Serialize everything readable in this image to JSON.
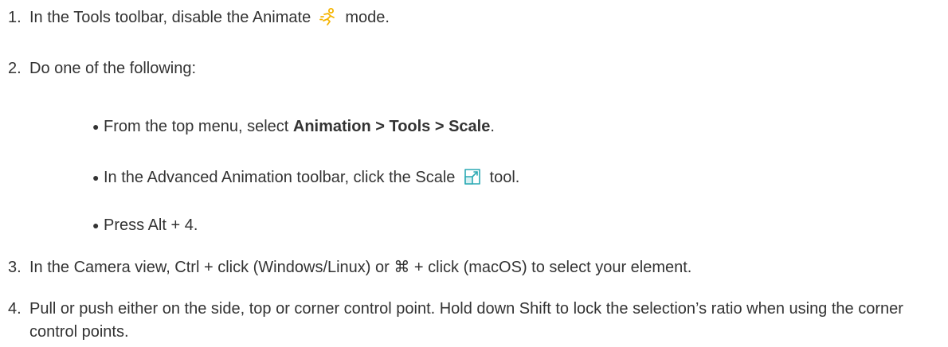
{
  "steps": [
    {
      "number": "1.",
      "before": "In the Tools toolbar, disable the Animate",
      "icon": "animate-mode-icon",
      "after": "mode."
    },
    {
      "number": "2.",
      "text": "Do one of the following:",
      "options": [
        {
          "before": "From the top menu, select ",
          "bold": "Animation > Tools > Scale",
          "after": "."
        },
        {
          "before": "In the Advanced Animation toolbar, click the Scale",
          "icon": "scale-tool-icon",
          "after": "tool."
        },
        {
          "text": "Press Alt + 4."
        }
      ]
    },
    {
      "number": "3.",
      "text": "In the Camera view, Ctrl + click (Windows/Linux) or ⌘ + click (macOS) to select your element."
    },
    {
      "number": "4.",
      "text": "Pull or push either on the side, top or corner control point. Hold down Shift to lock the selection’s ratio when using the corner control points."
    }
  ],
  "colors": {
    "text": "#333333",
    "animate_icon": "#f5b400",
    "scale_icon": "#2aa9b3"
  }
}
